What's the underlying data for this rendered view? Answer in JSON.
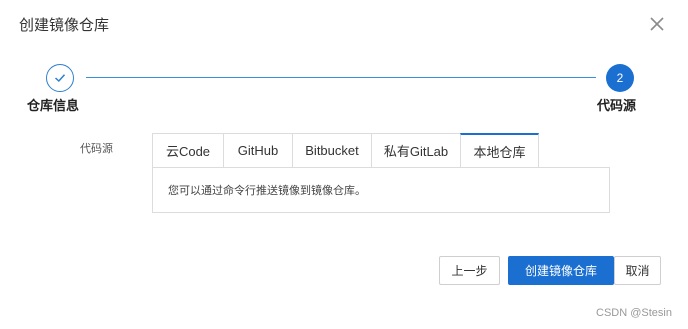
{
  "dialog": {
    "title": "创建镜像仓库",
    "close_icon": "close-icon"
  },
  "steps": [
    {
      "label": "仓库信息",
      "status": "completed",
      "icon": "check-icon"
    },
    {
      "label": "代码源",
      "number": "2",
      "status": "active"
    }
  ],
  "source": {
    "label": "代码源",
    "tabs": [
      {
        "label": "云Code"
      },
      {
        "label": "GitHub"
      },
      {
        "label": "Bitbucket"
      },
      {
        "label": "私有GitLab"
      },
      {
        "label": "本地仓库",
        "active": true
      }
    ],
    "panel_text": "您可以通过命令行推送镜像到镜像仓库。"
  },
  "footer": {
    "prev_label": "上一步",
    "create_label": "创建镜像仓库",
    "cancel_label": "取消"
  },
  "watermark": "CSDN @Stesin",
  "colors": {
    "accent": "#1a6fd0",
    "step_line": "#3a8fd8",
    "border": "#dcdcdc"
  }
}
